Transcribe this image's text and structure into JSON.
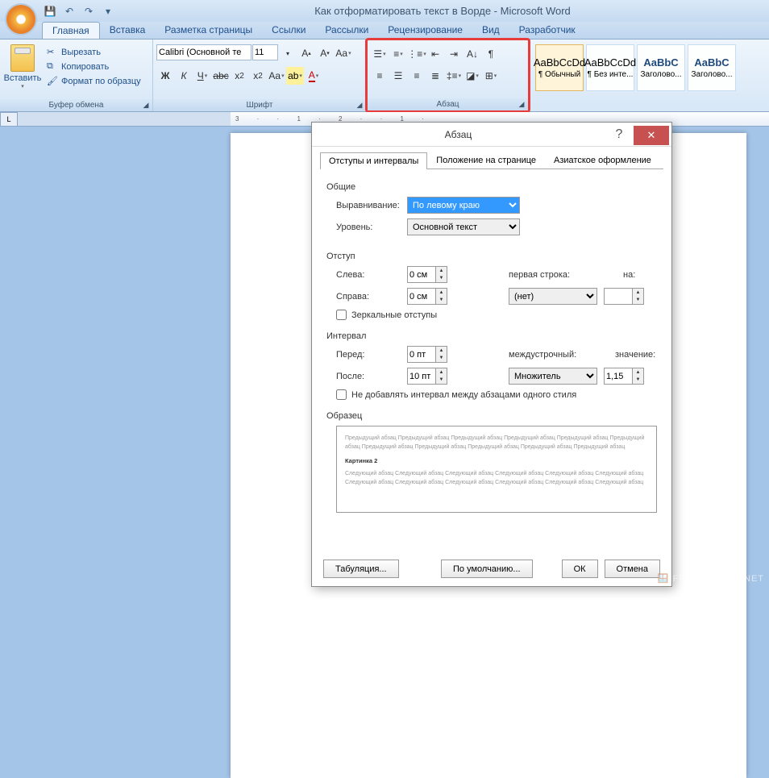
{
  "title": "Как отформатировать текст в Ворде - Microsoft Word",
  "qat": {
    "save": "💾",
    "undo": "↶",
    "redo": "↷"
  },
  "tabs": [
    "Главная",
    "Вставка",
    "Разметка страницы",
    "Ссылки",
    "Рассылки",
    "Рецензирование",
    "Вид",
    "Разработчик"
  ],
  "ribbon": {
    "clipboard": {
      "paste": "Вставить",
      "cut": "Вырезать",
      "copy": "Копировать",
      "format_painter": "Формат по образцу",
      "label": "Буфер обмена"
    },
    "font": {
      "family": "Calibri (Основной те",
      "size": "11",
      "label": "Шрифт"
    },
    "paragraph": {
      "label": "Абзац"
    },
    "styles": {
      "s1": {
        "preview": "AaBbCcDd",
        "name": "¶ Обычный"
      },
      "s2": {
        "preview": "AaBbCcDd",
        "name": "¶ Без инте..."
      },
      "s3": {
        "preview": "AaBbC",
        "name": "Заголово..."
      },
      "s4": {
        "preview": "AaBbC",
        "name": "Заголово..."
      }
    }
  },
  "dialog": {
    "title": "Абзац",
    "tabs": [
      "Отступы и интервалы",
      "Положение на странице",
      "Азиатское оформление"
    ],
    "general": {
      "label": "Общие",
      "alignment_lbl": "Выравнивание:",
      "alignment_val": "По левому краю",
      "level_lbl": "Уровень:",
      "level_val": "Основной текст"
    },
    "indent": {
      "label": "Отступ",
      "left_lbl": "Слева:",
      "left_val": "0 см",
      "right_lbl": "Справа:",
      "right_val": "0 см",
      "first_lbl": "первая строка:",
      "first_val": "(нет)",
      "by_lbl": "на:",
      "mirror": "Зеркальные отступы"
    },
    "spacing": {
      "label": "Интервал",
      "before_lbl": "Перед:",
      "before_val": "0 пт",
      "after_lbl": "После:",
      "after_val": "10 пт",
      "line_lbl": "междустрочный:",
      "line_val": "Множитель",
      "at_lbl": "значение:",
      "at_val": "1,15",
      "dont_add": "Не добавлять интервал между абзацами одного стиля"
    },
    "preview": {
      "label": "Образец",
      "prev_text": "Предыдущий абзац Предыдущий абзац Предыдущий абзац Предыдущий абзац Предыдущий абзац Предыдущий абзац Предыдущий абзац Предыдущий абзац Предыдущий абзац Предыдущий абзац Предыдущий абзац",
      "sample": "Картинка 2",
      "next_text": "Следующий абзац Следующий абзац Следующий абзац Следующий абзац Следующий абзац Следующий абзац Следующий абзац Следующий абзац Следующий абзац Следующий абзац Следующий абзац Следующий абзац"
    },
    "buttons": {
      "tabs": "Табуляция...",
      "default": "По умолчанию...",
      "ok": "ОК",
      "cancel": "Отмена"
    }
  },
  "ruler": {
    "marks": "3 · · 1 · 2 · · 1 ·"
  },
  "watermark": "🪟 FREE-OFFICE.NET"
}
